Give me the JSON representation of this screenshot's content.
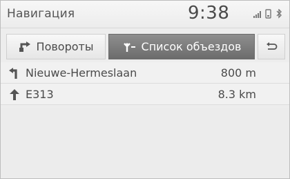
{
  "header": {
    "title": "Навигация",
    "time": "9:38"
  },
  "status_icons": [
    "signal-icon",
    "phone-icon",
    "bluetooth-icon"
  ],
  "tabs": [
    {
      "label": "Повороты",
      "icon": "turns-icon",
      "selected": false
    },
    {
      "label": "Список объездов",
      "icon": "detour-icon",
      "selected": true
    }
  ],
  "back_button": {
    "icon": "back-arrow-icon"
  },
  "route": [
    {
      "icon": "turn-left-icon",
      "name": "Nieuwe-Hermeslaan",
      "distance": "800 m"
    },
    {
      "icon": "straight-arrow-icon",
      "name": "E313",
      "distance": "8.3 km"
    }
  ],
  "colors": {
    "selected_tab": "#7c7c7c",
    "text": "#4a4a4a",
    "background": "#ededed"
  }
}
